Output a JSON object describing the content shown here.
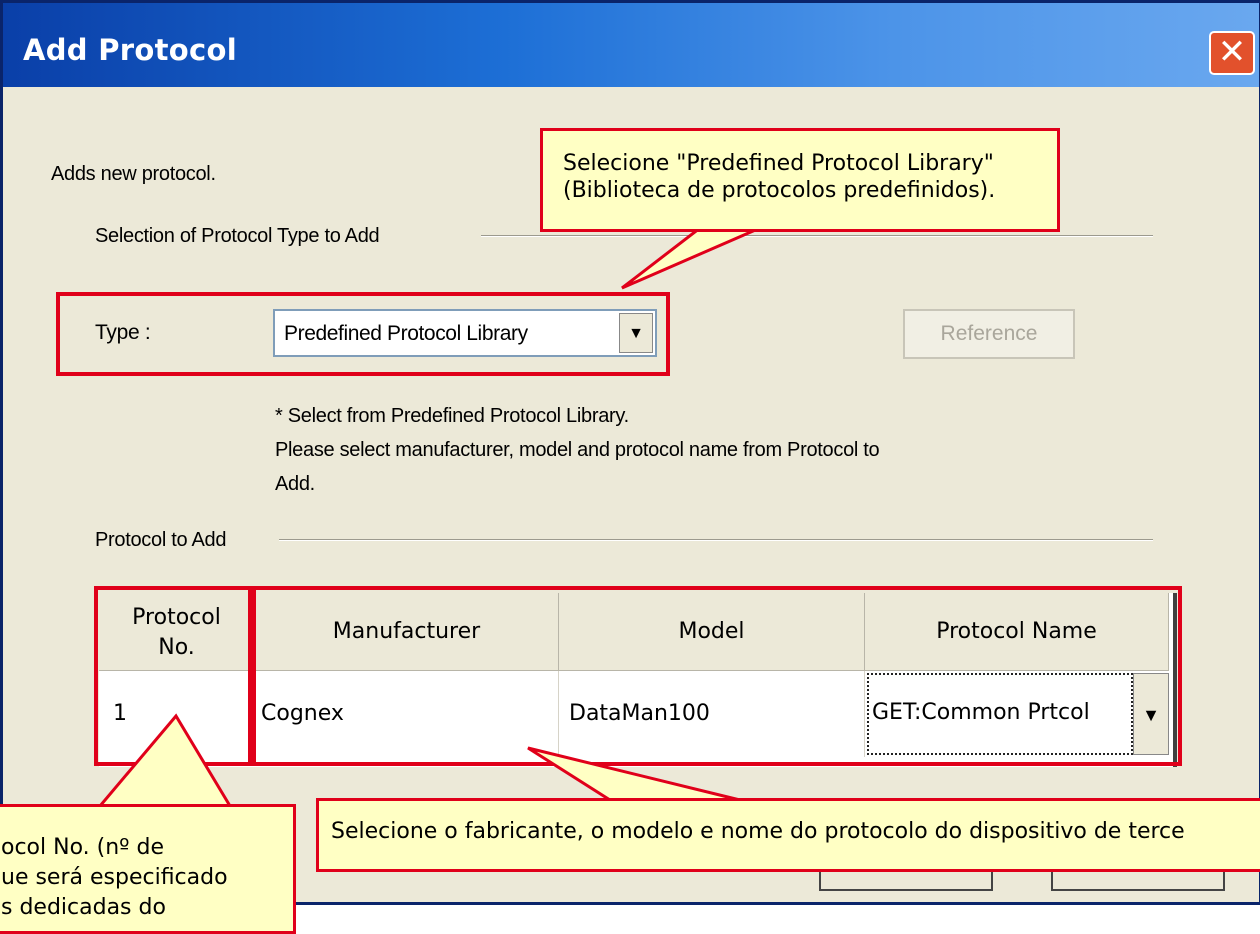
{
  "window": {
    "title": "Add Protocol",
    "close_glyph": "✕"
  },
  "description": "Adds new protocol.",
  "section_type": {
    "label": "Selection of Protocol Type to Add"
  },
  "type_field": {
    "label": "Type :",
    "value": "Predefined Protocol Library",
    "dropdown_glyph": "▼"
  },
  "reference_button": {
    "label": "Reference"
  },
  "note": {
    "line1": "* Select from Predefined Protocol Library.",
    "line2": "Please select manufacturer, model and protocol name from Protocol to",
    "line3": "Add."
  },
  "section_protocol": {
    "label": "Protocol to Add"
  },
  "table": {
    "headers": {
      "no_line1": "Protocol",
      "no_line2": "No.",
      "manufacturer": "Manufacturer",
      "model": "Model",
      "protocol_name": "Protocol Name"
    },
    "rows": [
      {
        "no": "1",
        "manufacturer": "Cognex",
        "model": "DataMan100",
        "protocol_name": "GET:Common Prtcol",
        "dropdown_glyph": "▼"
      }
    ]
  },
  "callouts": {
    "top": {
      "line1": "Selecione \"Predefined Protocol Library\"",
      "line2": "(Biblioteca de protocolos predefinidos)."
    },
    "bottom_right": {
      "text": "Selecione o fabricante, o modelo e nome do protocolo do dispositivo de terce"
    },
    "bottom_left": {
      "line1": "ocol No. (nº de",
      "line2": "ue será especificado",
      "line3": "s dedicadas do"
    }
  },
  "colors": {
    "highlight": "#e0001a",
    "callout_bg": "#ffffc4",
    "title_bar": "#0a3fa8",
    "dialog_bg": "#ece9d8"
  }
}
